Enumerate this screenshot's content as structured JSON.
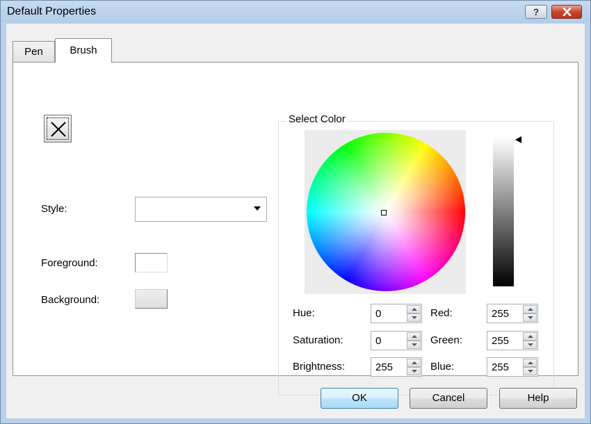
{
  "window": {
    "title": "Default Properties",
    "help_label": "?",
    "close_icon": "close-icon"
  },
  "tabs": [
    {
      "label": "Pen",
      "selected": false
    },
    {
      "label": "Brush",
      "selected": true
    }
  ],
  "brush": {
    "preview_icon": "x-icon",
    "style_label": "Style:",
    "style_value": "",
    "foreground_label": "Foreground:",
    "foreground_color": "#ffffff",
    "background_label": "Background:",
    "background_color": "#e3e3e3"
  },
  "select_color": {
    "title": "Select Color",
    "brightness_level": 1.0,
    "fields": {
      "hue": {
        "label": "Hue:",
        "value": "0"
      },
      "saturation": {
        "label": "Saturation:",
        "value": "0"
      },
      "brightness": {
        "label": "Brightness:",
        "value": "255"
      },
      "red": {
        "label": "Red:",
        "value": "255"
      },
      "green": {
        "label": "Green:",
        "value": "255"
      },
      "blue": {
        "label": "Blue:",
        "value": "255"
      }
    }
  },
  "buttons": {
    "ok": "OK",
    "cancel": "Cancel",
    "help": "Help"
  }
}
